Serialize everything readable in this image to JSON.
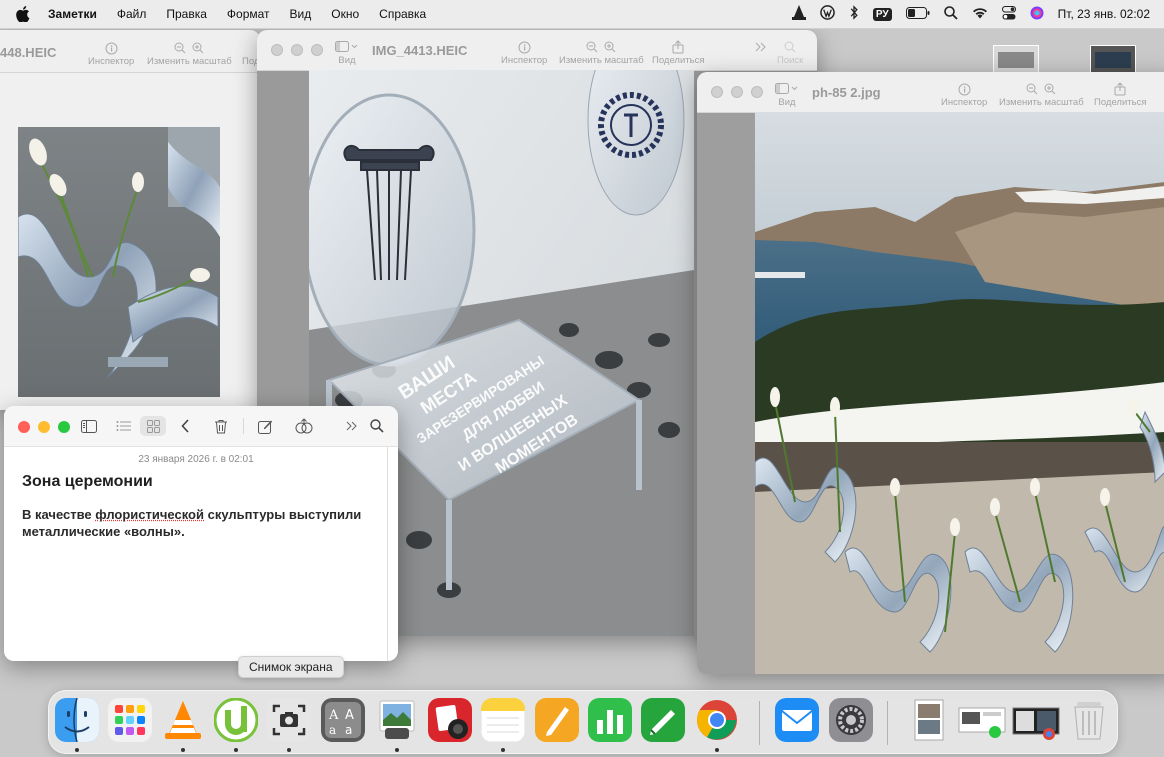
{
  "menubar": {
    "app_name": "Заметки",
    "items": [
      "Файл",
      "Правка",
      "Формат",
      "Вид",
      "Окно",
      "Справка"
    ],
    "input_source": "РУ",
    "clock": "Пт, 23 янв.  02:02"
  },
  "preview_left": {
    "title": "448.HEIC",
    "inspector": "Инспектор",
    "zoom": "Изменить масштаб",
    "share": "Поде"
  },
  "preview_mid": {
    "title": "IMG_4413.HEIC",
    "view": "Вид",
    "inspector": "Инспектор",
    "zoom": "Изменить масштаб",
    "share": "Поделиться",
    "search": "Поиск",
    "chair_text": "ВАШИ МЕСТА ЗАРЕЗЕРВИРОВАНЫ ДЛЯ ЛЮБВИ И ВОЛШЕБНЫХ МОМЕНТОВ"
  },
  "preview_right": {
    "title": "ph-85 2.jpg",
    "view": "Вид",
    "inspector": "Инспектор",
    "zoom": "Изменить масштаб",
    "share": "Поделиться"
  },
  "notes": {
    "date": "23 января 2026 г. в 02:01",
    "title": "Зона церемонии",
    "body_pre": "В качестве ",
    "body_misspelled": "флористической",
    "body_post": " скульптуры выступили металлические «волны»."
  },
  "tooltip": "Снимок экрана",
  "dock": {
    "apps": [
      "Finder",
      "Launchpad",
      "VLC",
      "uTorrent",
      "Screenshot",
      "Font Book",
      "Preview",
      "Photo Booth",
      "Notes",
      "Pages",
      "Numbers",
      "Keynote",
      "Chrome",
      "Mail",
      "System Settings",
      "Trash"
    ]
  },
  "colors": {
    "red_light": "#fe5f57",
    "yellow_light": "#febc2e",
    "green_light": "#28c840",
    "accent": "#0a84ff"
  }
}
